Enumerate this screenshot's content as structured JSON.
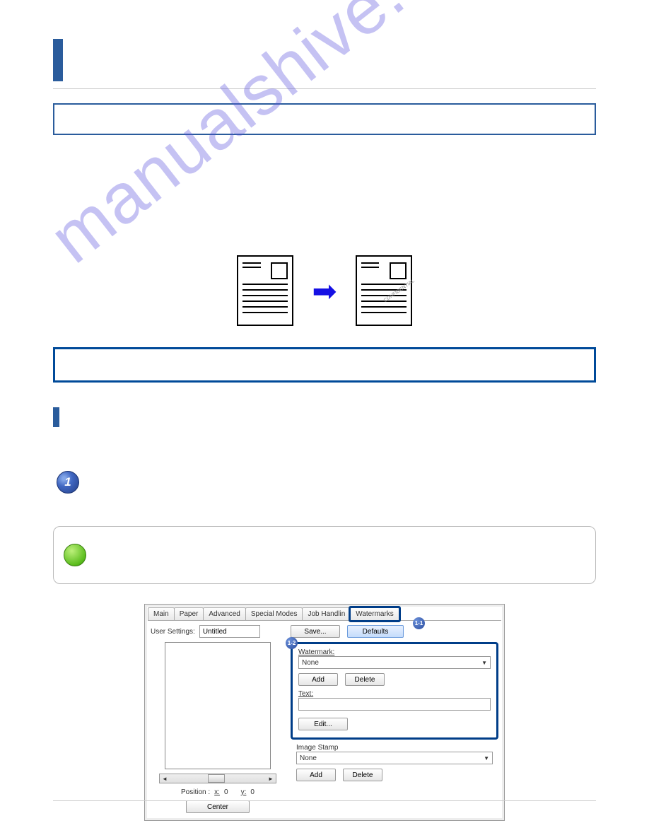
{
  "watermark_bg": "manualshive.com",
  "tabs": {
    "main": "Main",
    "paper": "Paper",
    "advanced": "Advanced",
    "special": "Special Modes",
    "job": "Job Handlin",
    "watermarks": "Watermarks"
  },
  "badges": {
    "b1": "1-1",
    "b2": "1-2"
  },
  "user_settings": {
    "label": "User Settings:",
    "value": "Untitled",
    "save": "Save...",
    "defaults": "Defaults"
  },
  "watermark": {
    "label": "Watermark:",
    "value": "None",
    "add": "Add",
    "delete": "Delete",
    "text_label": "Text:",
    "edit": "Edit..."
  },
  "image_stamp": {
    "label": "Image Stamp",
    "value": "None",
    "add": "Add",
    "delete": "Delete"
  },
  "position": {
    "label": "Position :",
    "xlabel": "x:",
    "x": "0",
    "ylabel": "y:",
    "y": "0",
    "center": "Center"
  },
  "scroll": {
    "left": "◄",
    "right": "►"
  },
  "step": "1",
  "preview_wm": "CONFIDENTIAL"
}
